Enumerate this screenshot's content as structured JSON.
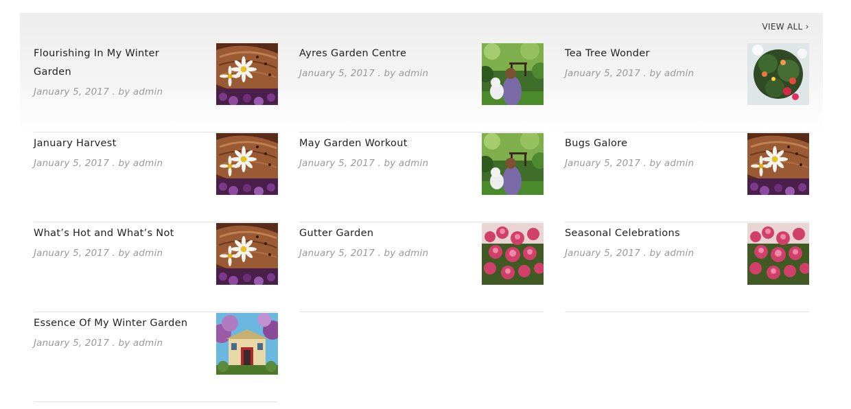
{
  "widget": {
    "view_all_label": "VIEW ALL",
    "view_all_icon": "chevron-right-icon"
  },
  "posts": [
    {
      "title": "Flourishing In My Winter Garden",
      "date": "January 5, 2017",
      "author": "by admin",
      "meta": "January 5, 2017 . by admin",
      "image": "daisies-in-wooden-bowl"
    },
    {
      "title": "Ayres Garden Centre",
      "date": "January 5, 2017",
      "author": "by admin",
      "meta": "January 5, 2017 . by admin",
      "image": "girl-with-dog-in-garden"
    },
    {
      "title": "Tea Tree Wonder",
      "date": "January 5, 2017",
      "author": "by admin",
      "meta": "January 5, 2017 . by admin",
      "image": "hanging-flower-basket"
    },
    {
      "title": "January Harvest",
      "date": "January 5, 2017",
      "author": "by admin",
      "meta": "January 5, 2017 . by admin",
      "image": "daisies-in-wooden-bowl"
    },
    {
      "title": "May Garden Workout",
      "date": "January 5, 2017",
      "author": "by admin",
      "meta": "January 5, 2017 . by admin",
      "image": "girl-with-dog-in-garden"
    },
    {
      "title": "Bugs Galore",
      "date": "January 5, 2017",
      "author": "by admin",
      "meta": "January 5, 2017 . by admin",
      "image": "daisies-in-wooden-bowl"
    },
    {
      "title": "What’s Hot and What’s Not",
      "date": "January 5, 2017",
      "author": "by admin",
      "meta": "January 5, 2017 . by admin",
      "image": "daisies-in-wooden-bowl"
    },
    {
      "title": "Gutter Garden",
      "date": "January 5, 2017",
      "author": "by admin",
      "meta": "January 5, 2017 . by admin",
      "image": "pink-flowers"
    },
    {
      "title": "Seasonal Celebrations",
      "date": "January 5, 2017",
      "author": "by admin",
      "meta": "January 5, 2017 . by admin",
      "image": "pink-flowers"
    },
    {
      "title": "Essence Of My Winter Garden",
      "date": "January 5, 2017",
      "author": "by admin",
      "meta": "January 5, 2017 . by admin",
      "image": "house-with-blossoms"
    }
  ]
}
